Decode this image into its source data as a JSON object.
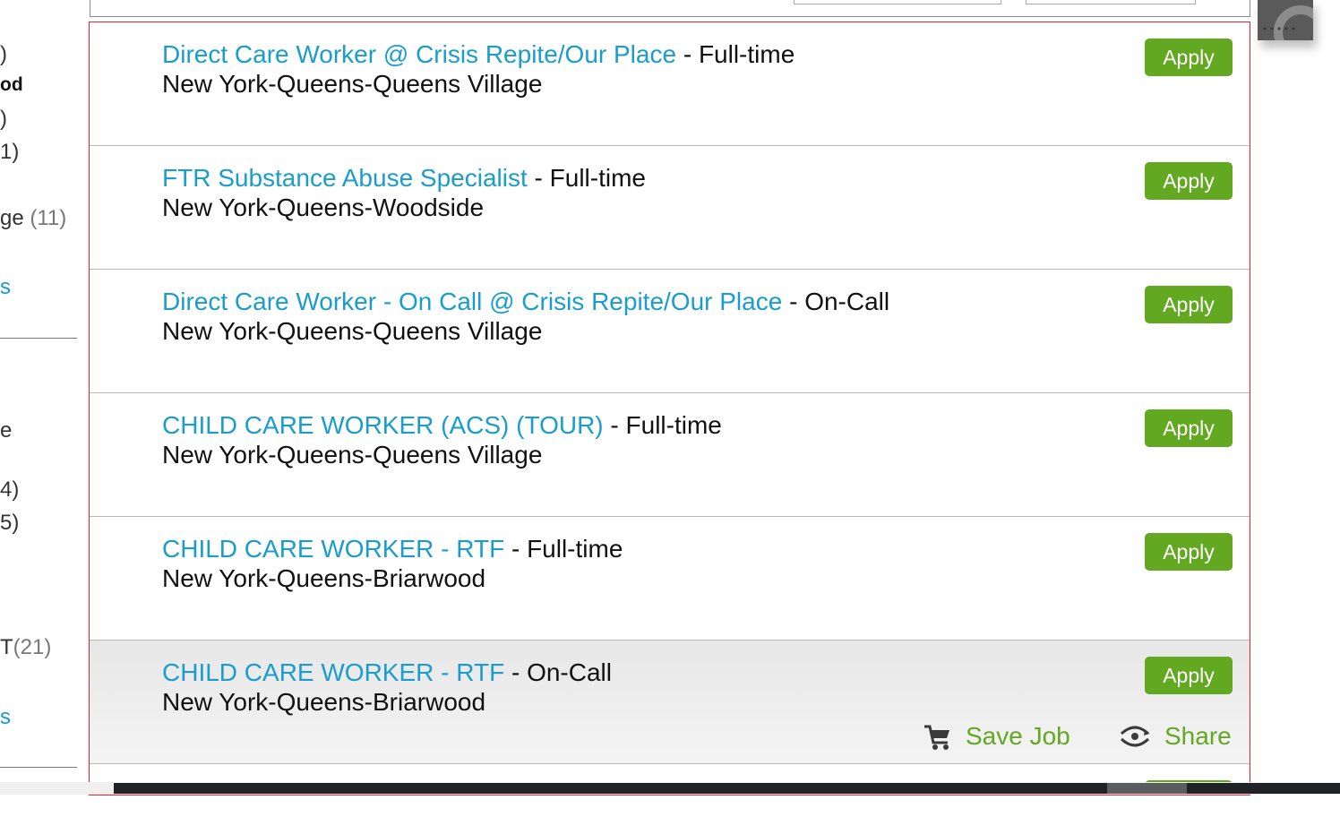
{
  "sidebar": {
    "filters": [
      {
        "label": ")",
        "count": ""
      },
      {
        "label": "od",
        "count": ""
      },
      {
        "label": ")",
        "count": ""
      },
      {
        "label": "1)",
        "count": ""
      },
      {
        "label": "ge",
        "count": "(11)"
      },
      {
        "label": "s",
        "count": ""
      },
      {
        "label": "e",
        "count": ""
      },
      {
        "label": "4)",
        "count": ""
      },
      {
        "label": "5)",
        "count": ""
      },
      {
        "label": "T",
        "count": "(21)"
      },
      {
        "label": "s",
        "count": ""
      }
    ]
  },
  "jobs": [
    {
      "title": "Direct Care Worker @ Crisis Repite/Our Place",
      "type": "Full-time",
      "location": "New York-Queens-Queens Village",
      "apply_label": "Apply"
    },
    {
      "title": "FTR Substance Abuse Specialist",
      "type": "Full-time",
      "location": "New York-Queens-Woodside",
      "apply_label": "Apply"
    },
    {
      "title": "Direct Care Worker - On Call @ Crisis Repite/Our Place",
      "type": "On-Call",
      "location": "New York-Queens-Queens Village",
      "apply_label": "Apply"
    },
    {
      "title": "CHILD CARE WORKER (ACS) (TOUR)",
      "type": "Full-time",
      "location": "New York-Queens-Queens Village",
      "apply_label": "Apply"
    },
    {
      "title": "CHILD CARE WORKER - RTF",
      "type": "Full-time",
      "location": "New York-Queens-Briarwood",
      "apply_label": "Apply"
    },
    {
      "title": "CHILD CARE WORKER - RTF",
      "type": "On-Call",
      "location": "New York-Queens-Briarwood",
      "apply_label": "Apply",
      "save_label": "Save Job",
      "share_label": "Share"
    }
  ],
  "separator": " - ",
  "colors": {
    "link": "#1a9dcc",
    "accent_green": "#62a821",
    "highlight_border": "#e0242a"
  },
  "icons": {
    "save": "cart-icon",
    "share": "share-icon"
  }
}
